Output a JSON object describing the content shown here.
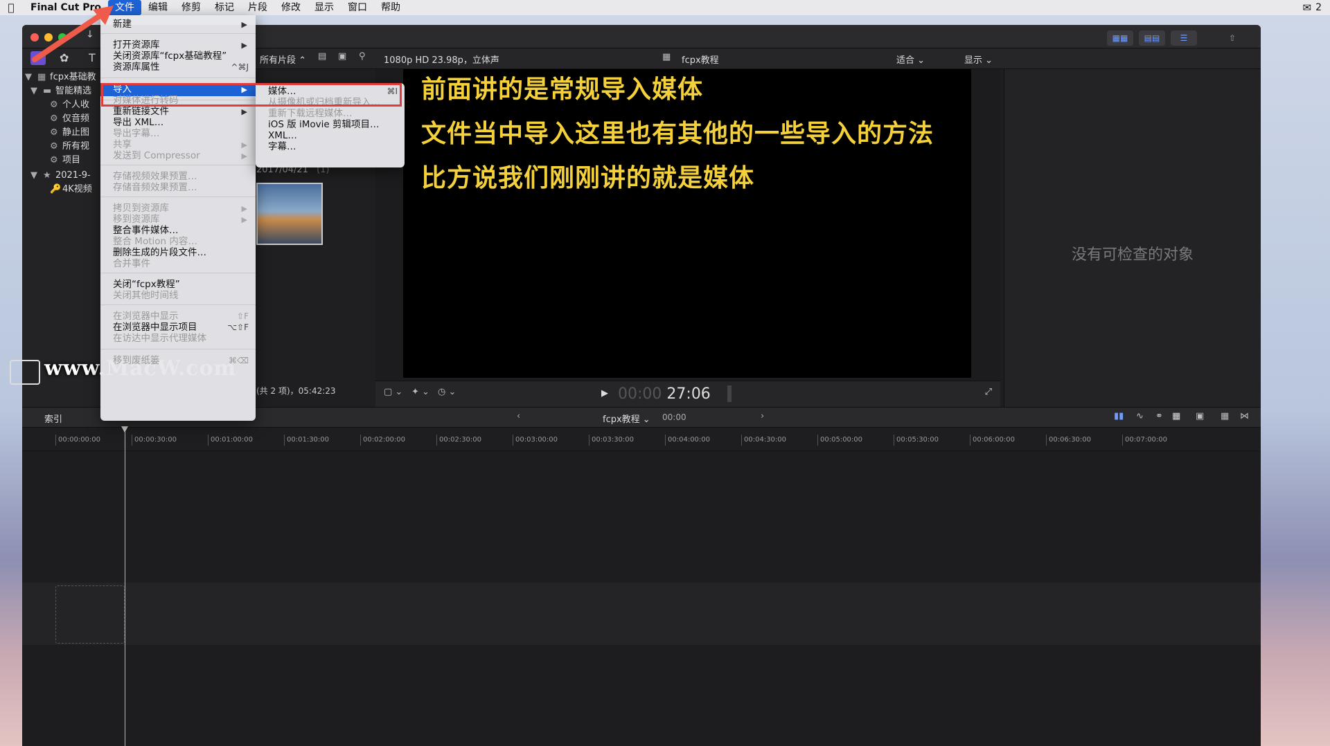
{
  "menubar": {
    "app_name": "Final Cut Pro",
    "items": [
      "文件",
      "编辑",
      "修剪",
      "标记",
      "片段",
      "修改",
      "显示",
      "窗口",
      "帮助"
    ],
    "wechat_count": "2"
  },
  "browser": {
    "filter_label": "所有片段 ⌃",
    "date_label": "2017/04/21",
    "date_count": "(1)",
    "status": "(共 2 项)，05:42:23"
  },
  "sidebar": {
    "library_name": "fcpx基础教",
    "items": [
      {
        "label": "智能精选"
      },
      {
        "label": "个人收"
      },
      {
        "label": "仅音频"
      },
      {
        "label": "静止图"
      },
      {
        "label": "所有视"
      },
      {
        "label": "项目"
      }
    ],
    "event_name": "2021-9-",
    "event_item": "4K视频"
  },
  "viewer": {
    "format": "1080p HD 23.98p，立体声",
    "project_name": "fcpx教程",
    "fit_label": "适合",
    "display_label": "显示",
    "subtitles": [
      "前面讲的是常规导入媒体",
      "文件当中导入这里也有其他的一些导入的方法",
      "比方说我们刚刚讲的就是媒体"
    ],
    "timecode_dim": "00:00",
    "timecode_bright": "27:06"
  },
  "inspector": {
    "empty_text": "没有可检查的对象"
  },
  "timeline": {
    "index_label": "索引",
    "project_label": "fcpx教程",
    "project_time": "00:00",
    "ruler": [
      "00:00:00:00",
      "00:00:30:00",
      "00:01:00:00",
      "00:01:30:00",
      "00:02:00:00",
      "00:02:30:00",
      "00:03:00:00",
      "00:03:30:00",
      "00:04:00:00",
      "00:04:30:00",
      "00:05:00:00",
      "00:05:30:00",
      "00:06:00:00",
      "00:06:30:00",
      "00:07:00:00"
    ]
  },
  "file_menu": {
    "items": [
      {
        "label": "新建",
        "shortcut": "",
        "arrow": true,
        "disabled": false
      },
      {
        "label": "打开资源库",
        "shortcut": "",
        "arrow": true,
        "disabled": false
      },
      {
        "label": "关闭资源库“fcpx基础教程”",
        "shortcut": "",
        "arrow": false,
        "disabled": false
      },
      {
        "label": "资源库属性",
        "shortcut": "^⌘J",
        "arrow": false,
        "disabled": false
      },
      {
        "label": "导入",
        "shortcut": "",
        "arrow": true,
        "disabled": false,
        "selected": true
      },
      {
        "label": "对媒体进行转码",
        "shortcut": "",
        "arrow": false,
        "disabled": true
      },
      {
        "label": "重新链接文件",
        "shortcut": "",
        "arrow": true,
        "disabled": false
      },
      {
        "label": "导出 XML…",
        "shortcut": "",
        "arrow": false,
        "disabled": false
      },
      {
        "label": "导出字幕…",
        "shortcut": "",
        "arrow": false,
        "disabled": true
      },
      {
        "label": "共享",
        "shortcut": "",
        "arrow": true,
        "disabled": true
      },
      {
        "label": "发送到 Compressor",
        "shortcut": "",
        "arrow": true,
        "disabled": true
      },
      {
        "label": "存储视频效果预置…",
        "shortcut": "",
        "arrow": false,
        "disabled": true
      },
      {
        "label": "存储音频效果预置…",
        "shortcut": "",
        "arrow": false,
        "disabled": true
      },
      {
        "label": "拷贝到资源库",
        "shortcut": "",
        "arrow": true,
        "disabled": true
      },
      {
        "label": "移到资源库",
        "shortcut": "",
        "arrow": true,
        "disabled": true
      },
      {
        "label": "整合事件媒体…",
        "shortcut": "",
        "arrow": false,
        "disabled": false
      },
      {
        "label": "整合 Motion 内容…",
        "shortcut": "",
        "arrow": false,
        "disabled": true
      },
      {
        "label": "删除生成的片段文件…",
        "shortcut": "",
        "arrow": false,
        "disabled": false
      },
      {
        "label": "合并事件",
        "shortcut": "",
        "arrow": false,
        "disabled": true
      },
      {
        "label": "关闭“fcpx教程”",
        "shortcut": "",
        "arrow": false,
        "disabled": false
      },
      {
        "label": "关闭其他时间线",
        "shortcut": "",
        "arrow": false,
        "disabled": true
      },
      {
        "label": "在浏览器中显示",
        "shortcut": "⇧F",
        "arrow": false,
        "disabled": true
      },
      {
        "label": "在浏览器中显示项目",
        "shortcut": "⌥⇧F",
        "arrow": false,
        "disabled": false
      },
      {
        "label": "在访达中显示代理媒体",
        "shortcut": "",
        "arrow": false,
        "disabled": true
      },
      {
        "label": "移到废纸篓",
        "shortcut": "⌘⌫",
        "arrow": false,
        "disabled": true
      }
    ]
  },
  "import_submenu": {
    "items": [
      {
        "label": "媒体…",
        "shortcut": "⌘I",
        "disabled": false
      },
      {
        "label": "从摄像机或归档重新导入…",
        "shortcut": "",
        "disabled": true
      },
      {
        "label": "重新下载远程媒体…",
        "shortcut": "",
        "disabled": true
      },
      {
        "label": "iOS 版 iMovie 剪辑项目…",
        "shortcut": "",
        "disabled": false
      },
      {
        "label": "XML…",
        "shortcut": "",
        "disabled": false
      },
      {
        "label": "字幕…",
        "shortcut": "",
        "disabled": false
      }
    ]
  },
  "watermark": "www.MacW.com"
}
